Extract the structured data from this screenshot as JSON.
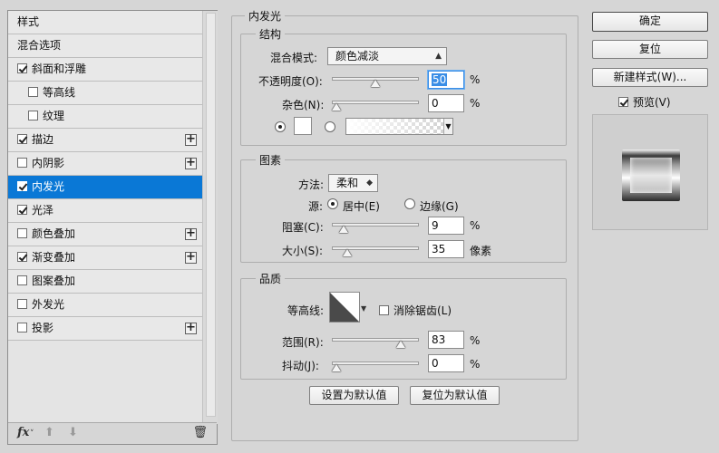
{
  "style_list": {
    "items": [
      {
        "label": "样式",
        "checkbox": false,
        "checked": false,
        "plus": false,
        "sub": false,
        "selected": false
      },
      {
        "label": "混合选项",
        "checkbox": false,
        "checked": false,
        "plus": false,
        "sub": false,
        "selected": false
      },
      {
        "label": "斜面和浮雕",
        "checkbox": true,
        "checked": true,
        "plus": false,
        "sub": false,
        "selected": false
      },
      {
        "label": "等高线",
        "checkbox": true,
        "checked": false,
        "plus": false,
        "sub": true,
        "selected": false
      },
      {
        "label": "纹理",
        "checkbox": true,
        "checked": false,
        "plus": false,
        "sub": true,
        "selected": false
      },
      {
        "label": "描边",
        "checkbox": true,
        "checked": true,
        "plus": true,
        "sub": false,
        "selected": false
      },
      {
        "label": "内阴影",
        "checkbox": true,
        "checked": false,
        "plus": true,
        "sub": false,
        "selected": false
      },
      {
        "label": "内发光",
        "checkbox": true,
        "checked": true,
        "plus": false,
        "sub": false,
        "selected": true
      },
      {
        "label": "光泽",
        "checkbox": true,
        "checked": true,
        "plus": false,
        "sub": false,
        "selected": false
      },
      {
        "label": "颜色叠加",
        "checkbox": true,
        "checked": false,
        "plus": true,
        "sub": false,
        "selected": false
      },
      {
        "label": "渐变叠加",
        "checkbox": true,
        "checked": true,
        "plus": true,
        "sub": false,
        "selected": false
      },
      {
        "label": "图案叠加",
        "checkbox": true,
        "checked": false,
        "plus": false,
        "sub": false,
        "selected": false
      },
      {
        "label": "外发光",
        "checkbox": true,
        "checked": false,
        "plus": false,
        "sub": false,
        "selected": false
      },
      {
        "label": "投影",
        "checkbox": true,
        "checked": false,
        "plus": true,
        "sub": false,
        "selected": false
      }
    ],
    "footer": {
      "fx": "fx",
      "fx_sub": "˅",
      "up": "⬆",
      "down": "⬇",
      "trash": "🗑"
    }
  },
  "panel": {
    "title": "内发光",
    "structure": {
      "title": "结构",
      "blend_mode_label": "混合模式:",
      "blend_mode_value": "颜色减淡",
      "opacity_label": "不透明度(O):",
      "opacity_value": "50",
      "opacity_unit": "%",
      "opacity_level": 0.5,
      "noise_label": "杂色(N):",
      "noise_value": "0",
      "noise_unit": "%",
      "noise_level": 0.0
    },
    "elements": {
      "title": "图素",
      "method_label": "方法:",
      "method_value": "柔和",
      "source_label": "源:",
      "source_center": "居中(E)",
      "source_edge": "边缘(G)",
      "choke_label": "阻塞(C):",
      "choke_value": "9",
      "choke_unit": "%",
      "choke_level": 0.09,
      "size_label": "大小(S):",
      "size_value": "35",
      "size_unit": "像素",
      "size_level": 0.14
    },
    "quality": {
      "title": "品质",
      "contour_label": "等高线:",
      "antialias_label": "消除锯齿(L)",
      "range_label": "范围(R):",
      "range_value": "83",
      "range_unit": "%",
      "range_level": 0.83,
      "jitter_label": "抖动(J):",
      "jitter_value": "0",
      "jitter_unit": "%",
      "jitter_level": 0.0
    },
    "set_default": "设置为默认值",
    "reset_default": "复位为默认值"
  },
  "right": {
    "ok": "确定",
    "reset": "复位",
    "new_style": "新建样式(W)...",
    "preview_label": "预览(V)"
  },
  "colors": {
    "selected_row": "#0a78d6",
    "focus": "#3a8ee6"
  }
}
